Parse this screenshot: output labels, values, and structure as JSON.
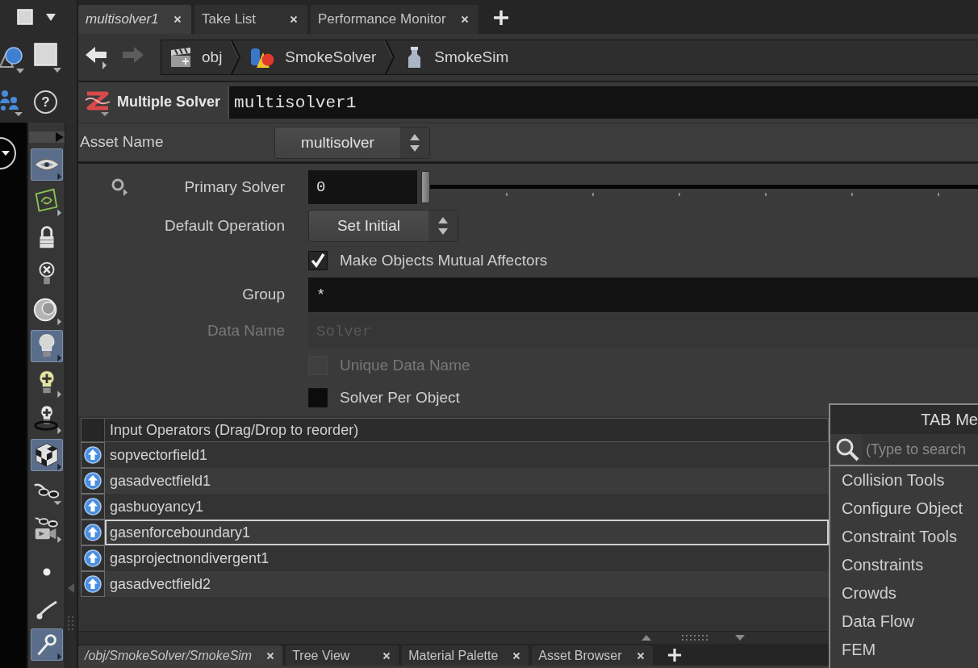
{
  "pane_tabs": [
    {
      "label": "multisolver1",
      "selected": true
    },
    {
      "label": "Take List",
      "selected": false
    },
    {
      "label": "Performance Monitor",
      "selected": false
    }
  ],
  "help_button": {
    "label": "?"
  },
  "shelf_tools": [
    {
      "kind": "eye",
      "on": true
    },
    {
      "kind": "wire",
      "on": false
    },
    {
      "kind": "lock",
      "on": false
    },
    {
      "kind": "nolight",
      "on": false
    },
    {
      "kind": "sphere",
      "on": false
    },
    {
      "kind": "light",
      "on": true
    },
    {
      "kind": "addlight",
      "on": false
    },
    {
      "kind": "ringlight",
      "on": false
    },
    {
      "kind": "checker",
      "on": true
    },
    {
      "kind": "glasses",
      "on": false
    },
    {
      "kind": "camglasses",
      "on": false
    },
    {
      "kind": "dot",
      "on": false
    },
    {
      "kind": "stroke",
      "on": false
    },
    {
      "kind": "pin",
      "on": true
    }
  ],
  "nav_buttons": [
    {
      "kind": "back",
      "disabled": false
    },
    {
      "kind": "forward",
      "disabled": true
    }
  ],
  "path": [
    {
      "kind": "obj",
      "label": "obj"
    },
    {
      "kind": "solver",
      "label": "SmokeSolver"
    },
    {
      "kind": "sim",
      "label": "SmokeSim"
    }
  ],
  "node": {
    "type_label": "Multiple Solver",
    "name": "multisolver1"
  },
  "asset": {
    "label": "Asset Name",
    "value": "multisolver"
  },
  "parameters": [
    {
      "kind": "slider",
      "label": "Primary Solver",
      "value": "0",
      "level": 0
    },
    {
      "kind": "menu",
      "label": "Default Operation",
      "value": "Set Initial"
    },
    {
      "kind": "toggle",
      "label": "Make Objects Mutual Affectors",
      "checked": true,
      "disabled": false
    },
    {
      "kind": "text",
      "label": "Group",
      "value": "*",
      "disabled": false
    },
    {
      "kind": "text",
      "label": "Data Name",
      "value": "Solver",
      "disabled": true
    },
    {
      "kind": "toggle",
      "label": "Unique Data Name",
      "checked": false,
      "disabled": true
    },
    {
      "kind": "toggle",
      "label": "Solver Per Object",
      "checked": false,
      "disabled": false
    }
  ],
  "input_operators": {
    "header": "Input Operators (Drag/Drop to reorder)",
    "rows": [
      {
        "name": "sopvectorfield1",
        "selected": false
      },
      {
        "name": "gasadvectfield1",
        "selected": false
      },
      {
        "name": "gasbuoyancy1",
        "selected": false
      },
      {
        "name": "gasenforceboundary1",
        "selected": true
      },
      {
        "name": "gasprojectnondivergent1",
        "selected": false
      },
      {
        "name": "gasadvectfield2",
        "selected": false
      }
    ]
  },
  "bottom_tabs": [
    {
      "label": "/obj/SmokeSolver/SmokeSim",
      "selected": true
    },
    {
      "label": "Tree View",
      "selected": false
    },
    {
      "label": "Material Palette",
      "selected": false
    },
    {
      "label": "Asset Browser",
      "selected": false
    }
  ],
  "tab_menu": {
    "title": "TAB Me",
    "placeholder": "(Type to search",
    "items": [
      "Collision Tools",
      "Configure Object",
      "Constraint Tools",
      "Constraints",
      "Crowds",
      "Data Flow",
      "FEM"
    ]
  }
}
